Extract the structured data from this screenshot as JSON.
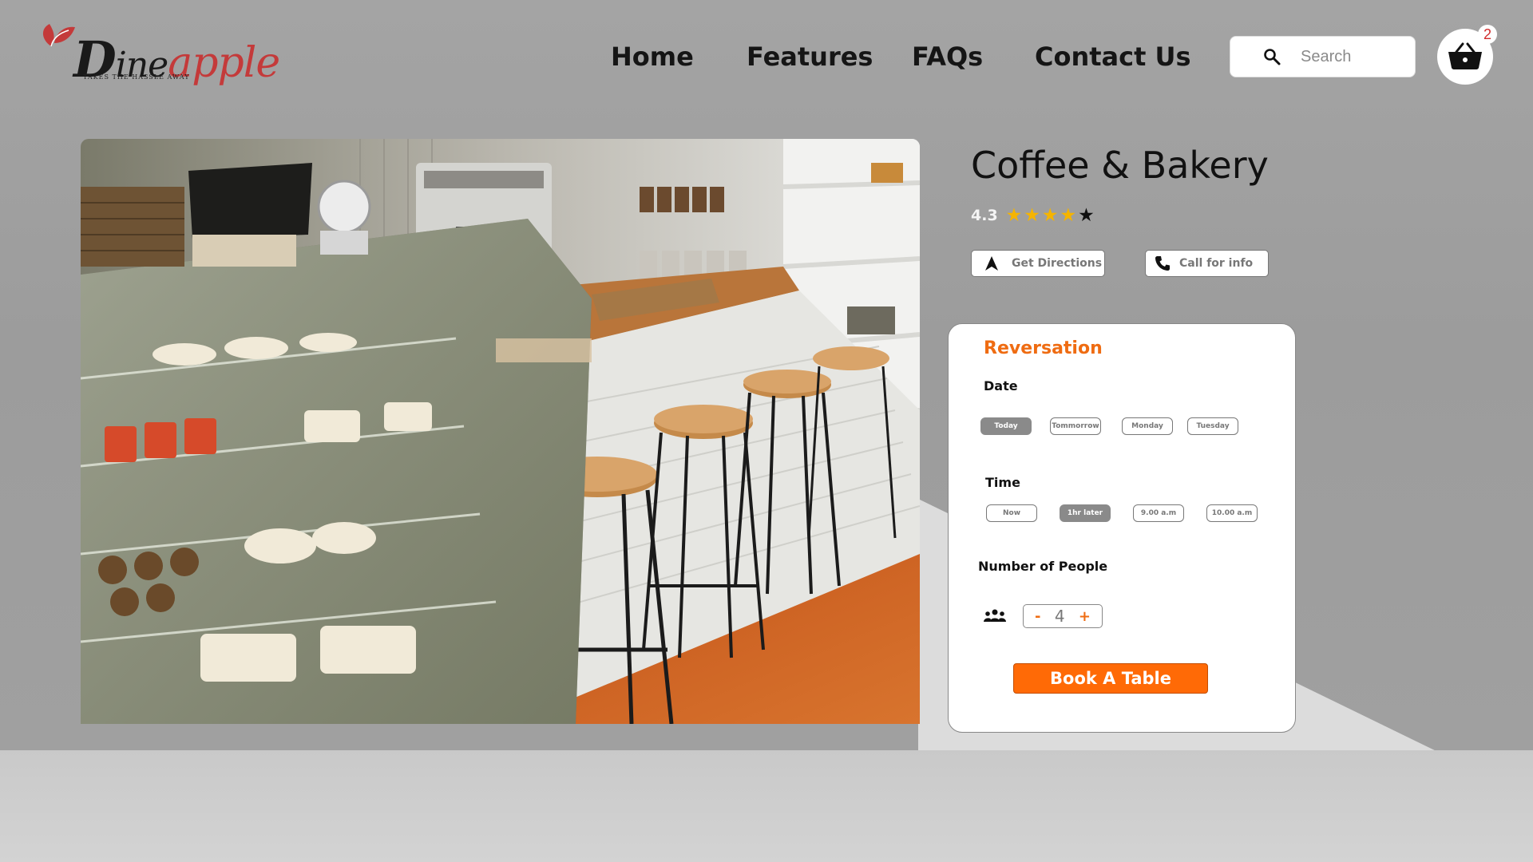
{
  "brand": {
    "logo_text": "Dineapple",
    "logo_text_parts": [
      "D",
      "ine",
      "apple"
    ],
    "tagline": "TAKES THE HASSLE AWAY"
  },
  "nav": {
    "items": [
      {
        "label": "Home"
      },
      {
        "label": "Features"
      },
      {
        "label": "FAQs"
      },
      {
        "label": "Contact Us"
      }
    ]
  },
  "search": {
    "placeholder": "Search"
  },
  "cart": {
    "count": "2"
  },
  "venue": {
    "name": "Coffee & Bakery",
    "rating": "4.3",
    "stars_filled": 4,
    "stars_total": 5,
    "photo_alt": "Cafe interior with pastry display case and bar stools"
  },
  "actions": {
    "directions_label": "Get Directions",
    "call_label": "Call for info"
  },
  "reservation": {
    "title": "Reversation",
    "date_label": "Date",
    "date_options": [
      "Today",
      "Tommorrow",
      "Monday",
      "Tuesday"
    ],
    "date_selected": "Today",
    "time_label": "Time",
    "time_options": [
      "Now",
      "1hr later",
      "9.00 a.m",
      "10.00 a.m"
    ],
    "time_selected": "1hr later",
    "people_label": "Number of People",
    "people_count": "4",
    "minus": "-",
    "plus": "+",
    "book_label": "Book A Table"
  },
  "colors": {
    "accent": "#ff6a06",
    "title_accent": "#ef6c12",
    "star": "#f5b400",
    "badge": "#d12b2b"
  }
}
